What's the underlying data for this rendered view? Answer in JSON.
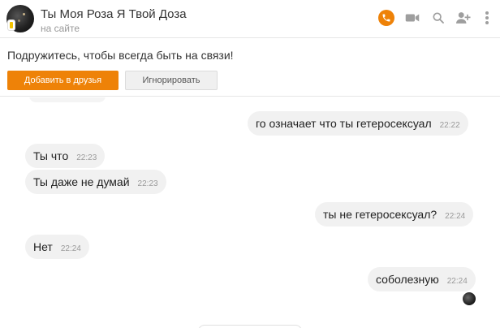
{
  "header": {
    "title": "Ты Моя Роза Я Твой Доза",
    "status": "на сайте",
    "icons": [
      "phone-icon",
      "video-icon",
      "search-icon",
      "add-user-icon",
      "more-icon"
    ],
    "accent_color": "#ee8208"
  },
  "friend_panel": {
    "text": "Подружитесь, чтобы всегда быть на связи!",
    "add_label": "Добавить в друзья",
    "ignore_label": "Игнорировать"
  },
  "messages": [
    {
      "side": "out",
      "text": "го означает что ты гетеросексуал",
      "time": "22:22"
    },
    {
      "side": "in",
      "text": "Ты  что",
      "time": "22:23"
    },
    {
      "side": "in",
      "text": "Ты даже  не думай",
      "time": "22:23"
    },
    {
      "side": "out",
      "text": "ты не гетеросексуал?",
      "time": "22:24"
    },
    {
      "side": "in",
      "text": "Нет",
      "time": "22:24"
    },
    {
      "side": "out",
      "text": "соболезную",
      "time": "22:24"
    }
  ]
}
